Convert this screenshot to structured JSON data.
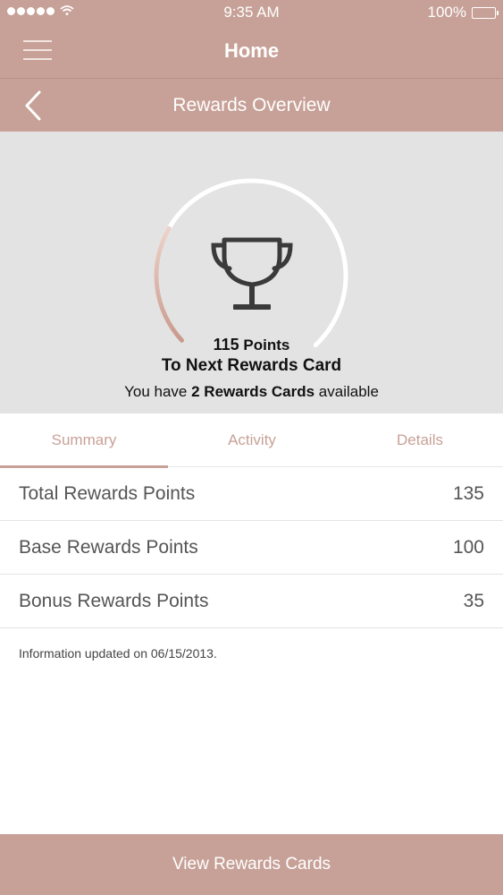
{
  "status_bar": {
    "time": "9:35 AM",
    "battery_percent": "100%",
    "signal_icon": "signal-dots-icon",
    "wifi_icon": "wifi-icon",
    "battery_icon": "battery-icon"
  },
  "nav": {
    "title": "Home",
    "menu_icon": "hamburger-menu-icon"
  },
  "sub_nav": {
    "title": "Rewards Overview",
    "back_icon": "chevron-left-icon"
  },
  "rewards": {
    "points_number": "115",
    "points_unit": "Points",
    "next_card_text": "To Next Rewards Card",
    "cards_prefix": "You have",
    "cards_count": "2 Rewards Cards",
    "cards_suffix": "available",
    "progress_fraction": 0.27,
    "trophy_icon": "trophy-icon"
  },
  "tabs": [
    {
      "label": "Summary",
      "active": true
    },
    {
      "label": "Activity",
      "active": false
    },
    {
      "label": "Details",
      "active": false
    }
  ],
  "summary_rows": [
    {
      "label": "Total Rewards Points",
      "value": "135"
    },
    {
      "label": "Base Rewards Points",
      "value": "100"
    },
    {
      "label": "Bonus Rewards Points",
      "value": "35"
    }
  ],
  "updated_text": "Information updated on 06/15/2013.",
  "bottom_button": "View Rewards Cards",
  "colors": {
    "brand": "#c7a197",
    "hero_bg": "#e3e3e3",
    "ring_progress": "#d1a89b",
    "ring_track": "#ffffff"
  }
}
